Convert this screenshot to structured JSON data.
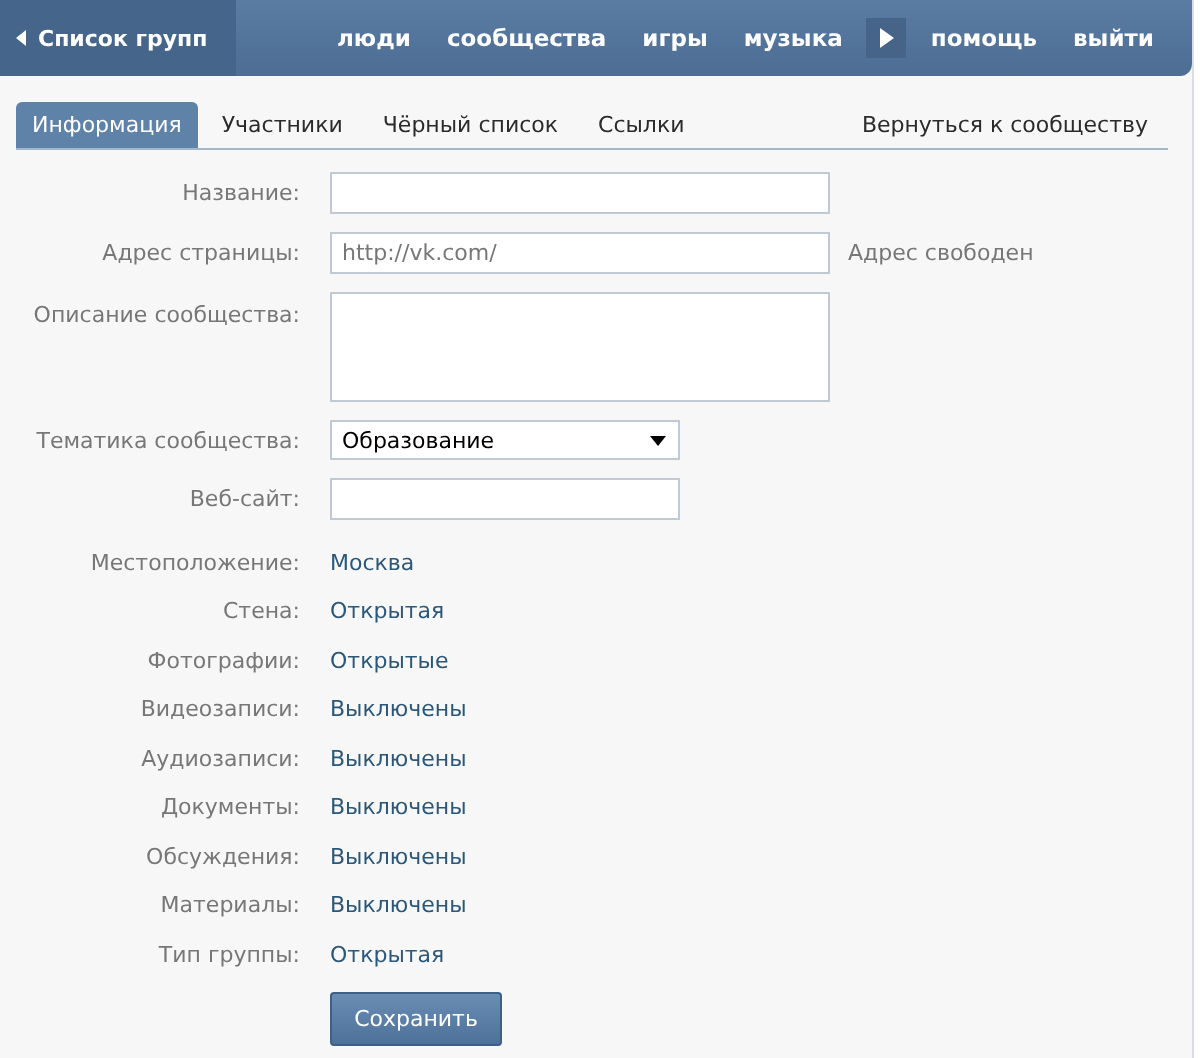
{
  "header": {
    "back_link": "Список групп",
    "nav": [
      "люди",
      "сообщества",
      "игры",
      "музыка"
    ],
    "nav_right": [
      "помощь",
      "выйти"
    ]
  },
  "tabs": [
    {
      "label": "Информация",
      "selected": true
    },
    {
      "label": "Участники",
      "selected": false
    },
    {
      "label": "Чёрный список",
      "selected": false
    },
    {
      "label": "Ссылки",
      "selected": false
    }
  ],
  "return_link": "Вернуться к сообществу",
  "fields": [
    {
      "kind": "text",
      "label": "Название:"
    },
    {
      "kind": "text",
      "label": "Адрес страницы:",
      "value": "http://vk.com/",
      "note": "Адрес свободен"
    },
    {
      "kind": "textarea",
      "label": "Описание сообщества:"
    },
    {
      "kind": "select",
      "label": "Тематика сообщества:",
      "value": "Образование"
    },
    {
      "kind": "short",
      "label": "Веб-сайт:"
    }
  ],
  "settings": [
    {
      "label": "Местоположение:",
      "value": "Москва"
    },
    {
      "label": "Стена:",
      "value": "Открытая"
    },
    {
      "label": "Фотографии:",
      "value": "Открытые"
    },
    {
      "label": "Видеозаписи:",
      "value": "Выключены"
    },
    {
      "label": "Аудиозаписи:",
      "value": "Выключены"
    },
    {
      "label": "Документы:",
      "value": "Выключены"
    },
    {
      "label": "Обсуждения:",
      "value": "Выключены"
    },
    {
      "label": "Материалы:",
      "value": "Выключены"
    },
    {
      "label": "Тип группы:",
      "value": "Открытая"
    }
  ],
  "save_button": "Сохранить"
}
